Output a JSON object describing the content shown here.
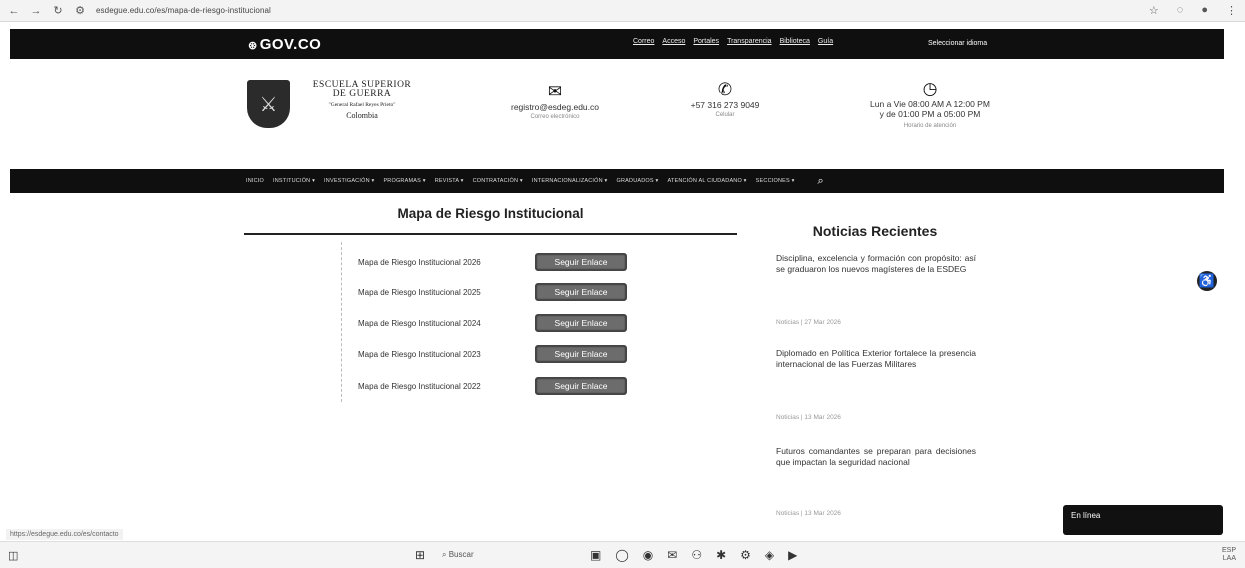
{
  "browser": {
    "url": "esdegue.edu.co/es/mapa-de-riesgo-institucional"
  },
  "govbar": {
    "logo": "GOV.CO",
    "links": [
      "Correo",
      "Acceso",
      "Portales",
      "Transparencia",
      "Biblioteca",
      "Guía"
    ],
    "language": "Seleccionar idioma"
  },
  "header": {
    "school_name_line1": "ESCUELA SUPERIOR",
    "school_name_line2": "DE GUERRA",
    "school_subtitle": "\"General Rafael Reyes Prieto\"",
    "country": "Colombia",
    "email": "registro@esdeg.edu.co",
    "email_sub": "Correo electrónico",
    "phone": "+57 316 273 9049",
    "phone_sub": "Celular",
    "hours_line1": "Lun a Vie 08:00 AM A 12:00 PM",
    "hours_line2": "y de 01:00 PM a 05:00 PM",
    "hours_sub": "Horario de atención"
  },
  "nav": {
    "items": [
      "INICIO",
      "INSTITUCIÓN ▾",
      "INVESTIGACIÓN ▾",
      "PROGRAMAS ▾",
      "REVISTA ▾",
      "CONTRATACIÓN ▾",
      "INTERNACIONALIZACIÓN ▾",
      "GRADUADOS ▾",
      "ATENCIÓN AL CIUDADANO ▾",
      "SECCIONES ▾"
    ]
  },
  "main": {
    "title": "Mapa de Riesgo Institucional",
    "rows": [
      {
        "label": "Mapa de Riesgo Institucional 2026",
        "button": "Seguir Enlace"
      },
      {
        "label": "Mapa de Riesgo Institucional 2025",
        "button": "Seguir Enlace"
      },
      {
        "label": "Mapa de Riesgo Institucional 2024",
        "button": "Seguir Enlace"
      },
      {
        "label": "Mapa de Riesgo Institucional 2023",
        "button": "Seguir Enlace"
      },
      {
        "label": "Mapa de Riesgo Institucional 2022",
        "button": "Seguir Enlace"
      }
    ]
  },
  "news": {
    "title": "Noticias Recientes",
    "items": [
      {
        "text": "Disciplina, excelencia y formación con propósito: así se graduaron los nuevos magísteres de la ESDEG",
        "meta": "Noticias | 27 Mar 2026"
      },
      {
        "text": "Diplomado en Política Exterior fortalece la presencia internacional de las Fuerzas Militares",
        "meta": "Noticias | 13 Mar 2026"
      },
      {
        "text": "Futuros comandantes se preparan para decisiones que impactan la seguridad nacional",
        "meta": "Noticias | 13 Mar 2026"
      }
    ]
  },
  "chat": {
    "label": "En línea"
  },
  "status_url": "https://esdegue.edu.co/es/contacto",
  "taskbar": {
    "search": "Buscar",
    "tray_line1": "ESP",
    "tray_line2": "LAA"
  }
}
